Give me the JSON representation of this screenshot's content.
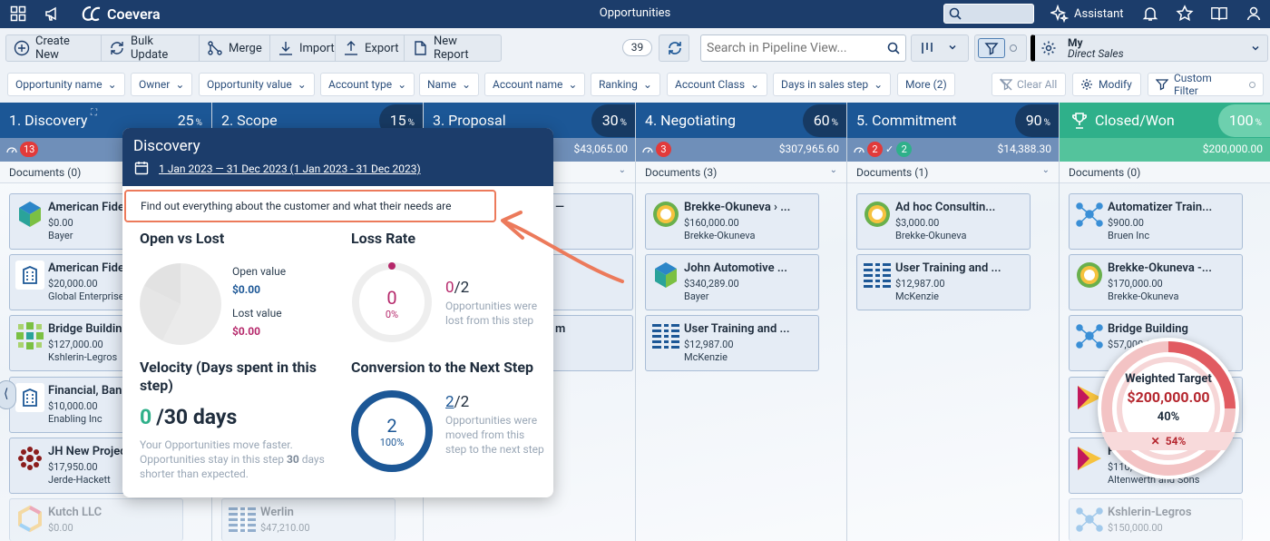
{
  "app": {
    "brand": "Coevera",
    "title": "Opportunities",
    "assistant": "Assistant"
  },
  "toolbar": {
    "items": [
      {
        "label": "Create New",
        "icon": "plus-circle-icon"
      },
      {
        "label": "Bulk Update",
        "icon": "bulk-update-icon"
      },
      {
        "label": "Merge",
        "icon": "merge-icon"
      },
      {
        "label": "Import",
        "icon": "import-icon"
      },
      {
        "label": "Export",
        "icon": "export-icon"
      },
      {
        "label": "New Report",
        "icon": "report-icon"
      }
    ],
    "count": "39",
    "search_placeholder": "Search in Pipeline View...",
    "view_line1": "My",
    "view_line2": "Direct Sales"
  },
  "filters": {
    "chips": [
      "Opportunity name",
      "Owner",
      "Opportunity value",
      "Account type",
      "Name",
      "Account name",
      "Ranking",
      "Account Class",
      "Days in sales step",
      "More (2)"
    ],
    "clear_all": "Clear All",
    "modify": "Modify",
    "custom_filter": "Custom Filter"
  },
  "columns": [
    {
      "name": "1. Discovery",
      "pct": "25",
      "amount": "",
      "badges": [
        {
          "value": "13",
          "color": "#e23a3a"
        }
      ],
      "docs": "Documents (0)",
      "cards": [
        {
          "name": "American Fide",
          "amount": "$0.00",
          "owner": "Bayer",
          "logo": "cube-logo"
        },
        {
          "name": "American Fide",
          "amount": "$20,000.00",
          "owner": "Global Enterprise",
          "logo": "building-logo"
        },
        {
          "name": "Bridge Building",
          "amount": "$127,000.00",
          "owner": "Kshlerin-Legros",
          "logo": "grid-logo"
        },
        {
          "name": "Financial, Ban",
          "amount": "$10,000.00",
          "owner": "Enabling Inc",
          "logo": "building-logo"
        },
        {
          "name": "JH New Projec",
          "amount": "$17,950.00",
          "owner": "Jerde-Hackett",
          "logo": "dots-logo"
        },
        {
          "name": "Kutch LLC",
          "amount": "$0.00",
          "owner": "",
          "logo": "hex-logo"
        }
      ]
    },
    {
      "name": "2. Scope",
      "pct": "15",
      "amount": "",
      "badges": [],
      "docs": "",
      "cards": [
        {
          "name": "Werlin",
          "amount": "$47,210.00",
          "owner": "",
          "logo": "lines-logo"
        }
      ]
    },
    {
      "name": "3. Proposal",
      "pct": "30",
      "amount": "$43,065.00",
      "badges": [],
      "docs": "",
      "cards": []
    },
    {
      "name": "4. Negotiating",
      "pct": "60",
      "amount": "$307,965.60",
      "badges": [
        {
          "value": "3",
          "color": "#e23a3a"
        }
      ],
      "docs": "Documents (3)",
      "cards": [
        {
          "name": "Brekke-Okuneva › ...",
          "amount": "$160,000.00",
          "owner": "Brekke-Okuneva",
          "logo": "sun-logo"
        },
        {
          "name": "John Automotive ...",
          "amount": "$340,289.00",
          "owner": "Bayer",
          "logo": "cube-logo"
        },
        {
          "name": "User Training and ...",
          "amount": "$12,987.00",
          "owner": "McKenzie",
          "logo": "lines-logo"
        }
      ]
    },
    {
      "name": "5. Commitment",
      "pct": "90",
      "amount": "$14,388.30",
      "badges": [
        {
          "value": "2",
          "color": "#e23a3a"
        },
        {
          "value": "2",
          "color": "#2fb08a"
        }
      ],
      "docs": "Documents (1)",
      "cards": [
        {
          "name": "Ad hoc Consultin...",
          "amount": "$3,000.00",
          "owner": "Brekke-Okuneva",
          "logo": "sun-logo"
        },
        {
          "name": "User Training and ...",
          "amount": "$12,987.00",
          "owner": "McKenzie",
          "logo": "lines-logo"
        }
      ]
    },
    {
      "name": "Closed/Won",
      "pct": "100",
      "amount": "$200,000.00",
      "badges": [],
      "docs": "Documents (0)",
      "cards": [
        {
          "name": "Automatizer Train...",
          "amount": "$900.00",
          "owner": "Bruen Inc",
          "logo": "network-logo"
        },
        {
          "name": "Brekke-Okuneva -...",
          "amount": "$170,000.00",
          "owner": "Brekke-Okuneva",
          "logo": "sun-logo"
        },
        {
          "name": "Bridge Building",
          "amount": "$57,000.00",
          "owner": "",
          "logo": "network-logo"
        },
        {
          "name": "",
          "amount": "",
          "owner": "",
          "logo": "triangle-logo"
        },
        {
          "name": "F",
          "amount": "$110,000.00",
          "owner": "Altenwerth and Sons",
          "logo": "triangle-logo"
        },
        {
          "name": "Kshlerin-Legros",
          "amount": "$150,000.00",
          "owner": "",
          "logo": "network-logo"
        }
      ]
    }
  ],
  "popover": {
    "title": "Discovery",
    "date_range": "1 Jan 2023 — 31 Dec 2023 (1 Jan 2023 - 31 Dec 2023)",
    "description": "Find out everything about the customer and what their needs are",
    "open_vs_lost": {
      "heading": "Open vs Lost",
      "open_label": "Open value",
      "open_value": "$0.00",
      "lost_label": "Lost value",
      "lost_value": "$0.00"
    },
    "loss_rate": {
      "heading": "Loss Rate",
      "center_value": "0",
      "center_pct": "0%",
      "numerator": "0",
      "denominator": "/2",
      "note": "Opportunities were lost from this step"
    },
    "velocity": {
      "heading": "Velocity (Days spent in this step)",
      "value": "0",
      "suffix": "/30 days",
      "note_prefix": "Your Opportunities move faster. Opportunities stay in this step ",
      "note_bold": "30",
      "note_suffix": " days shorter than expected."
    },
    "conversion": {
      "heading": "Conversion to the Next Step",
      "center_value": "2",
      "center_pct": "100%",
      "numerator": "2",
      "denominator": "/2",
      "note": "Opportunities were moved from this step to the next step",
      "fraction": 1.0
    }
  },
  "weighted_target": {
    "label": "Weighted Target",
    "amount": "$200,000.00",
    "pct": "40%",
    "delta": "54%"
  },
  "colors": {
    "topbar": "#1c3d6b",
    "column_header": "#1c5796",
    "closed_won": "#2fb08a",
    "accent_teal": "#2fb08a",
    "accent_red": "#b5272f",
    "annotation": "#ec7a5b"
  }
}
